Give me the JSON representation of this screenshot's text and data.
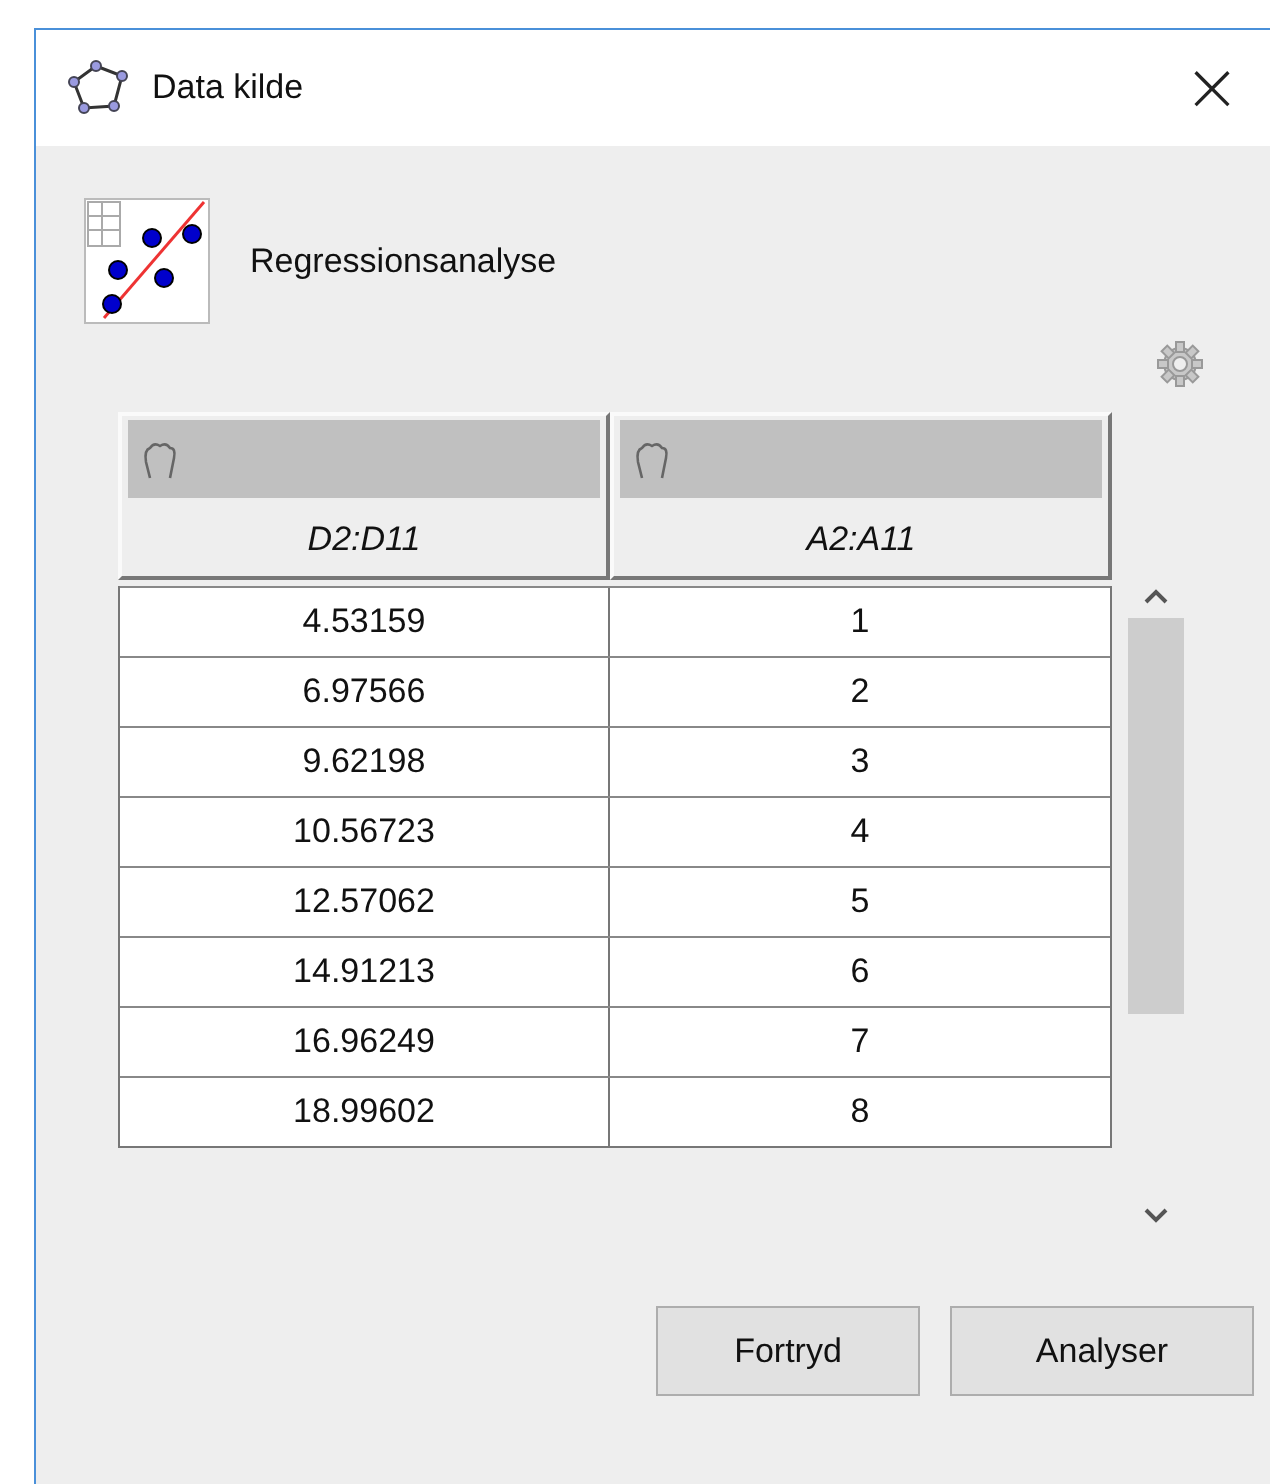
{
  "window": {
    "title": "Data kilde",
    "close": "×"
  },
  "analysis": {
    "label": "Regressionsanalyse"
  },
  "table": {
    "columns": [
      {
        "label": "D2:D11"
      },
      {
        "label": "A2:A11"
      }
    ],
    "rows": [
      [
        "4.53159",
        "1"
      ],
      [
        "6.97566",
        "2"
      ],
      [
        "9.62198",
        "3"
      ],
      [
        "10.56723",
        "4"
      ],
      [
        "12.57062",
        "5"
      ],
      [
        "14.91213",
        "6"
      ],
      [
        "16.96249",
        "7"
      ],
      [
        "18.99602",
        "8"
      ]
    ]
  },
  "buttons": [
    "Fortryd",
    "Analyser"
  ]
}
